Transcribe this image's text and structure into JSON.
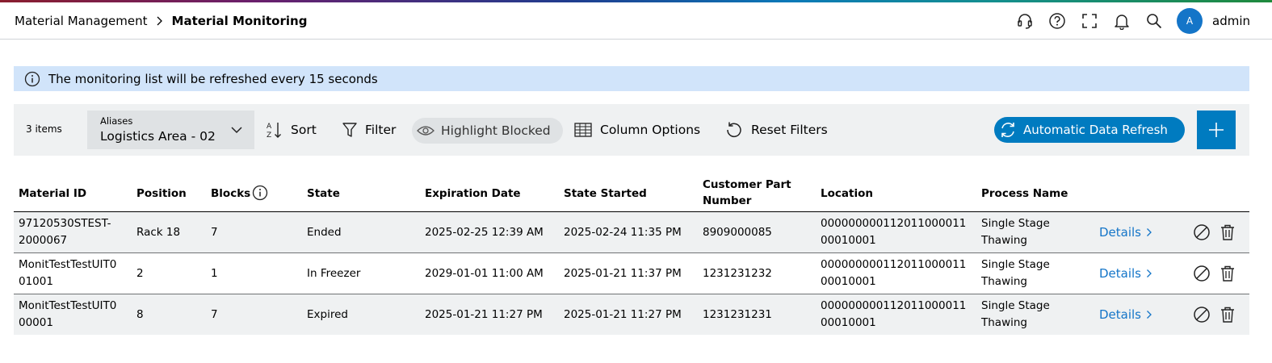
{
  "header": {
    "breadcrumb_parent": "Material Management",
    "breadcrumb_current": "Material Monitoring",
    "icons": [
      "headset-icon",
      "help-icon",
      "fullscreen-icon",
      "bell-icon",
      "search-icon"
    ],
    "avatar_initial": "A",
    "user_name": "admin"
  },
  "banner": {
    "text": "The monitoring list will be refreshed every 15 seconds"
  },
  "toolbar": {
    "items_count": "3 items",
    "aliases_label": "Aliases",
    "aliases_value": "Logistics Area - 02",
    "sort_label": "Sort",
    "filter_label": "Filter",
    "highlight_label": "Highlight Blocked",
    "column_options_label": "Column Options",
    "reset_filters_label": "Reset Filters",
    "auto_refresh_label": "Automatic Data Refresh"
  },
  "table": {
    "columns": {
      "material_id": "Material ID",
      "position": "Position",
      "blocks": "Blocks",
      "state": "State",
      "expiration_date": "Expiration Date",
      "state_started": "State Started",
      "customer_part_number_1": "Customer Part",
      "customer_part_number_2": "Number",
      "location": "Location",
      "process_name": "Process Name"
    },
    "details_label": "Details",
    "rows": [
      {
        "material_id_1": "97120530STEST-",
        "material_id_2": "2000067",
        "position": "Rack 18",
        "blocks": "7",
        "state": "Ended",
        "expiration_date": "2025-02-25 12:39 AM",
        "state_started": "2025-02-24 11:35 PM",
        "customer_part_number": "8909000085",
        "location_1": "000000000112011000011",
        "location_2": "00010001",
        "process_name_1": "Single Stage",
        "process_name_2": "Thawing"
      },
      {
        "material_id_1": "MonitTestTestUIT0",
        "material_id_2": "01001",
        "position": "2",
        "blocks": "1",
        "state": "In Freezer",
        "expiration_date": "2029-01-01 11:00 AM",
        "state_started": "2025-01-21 11:37 PM",
        "customer_part_number": "1231231232",
        "location_1": "000000000112011000011",
        "location_2": "00010001",
        "process_name_1": "Single Stage",
        "process_name_2": "Thawing"
      },
      {
        "material_id_1": "MonitTestTestUIT0",
        "material_id_2": "00001",
        "position": "8",
        "blocks": "7",
        "state": "Expired",
        "expiration_date": "2025-01-21 11:27 PM",
        "state_started": "2025-01-21 11:27 PM",
        "customer_part_number": "1231231231",
        "location_1": "000000000112011000011",
        "location_2": "00010001",
        "process_name_1": "Single Stage",
        "process_name_2": "Thawing"
      }
    ]
  },
  "colors": {
    "accent": "#007bc0",
    "banner_bg": "#d1e4fa",
    "toolbar_bg": "#eff1f2",
    "link": "#1475c8"
  }
}
